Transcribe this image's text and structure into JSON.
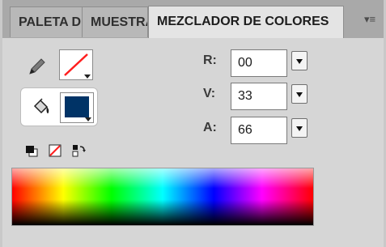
{
  "tabs": [
    {
      "label": "PALETA DE COLORES"
    },
    {
      "label": "MUESTRAS"
    },
    {
      "label": "MEZCLADOR DE COLORES"
    }
  ],
  "colors": {
    "stroke": "none",
    "fill": "#003366"
  },
  "fields": {
    "r": {
      "label": "R:",
      "value": "00"
    },
    "v": {
      "label": "V:",
      "value": "33"
    },
    "a": {
      "label": "A:",
      "value": "66"
    }
  },
  "icons": {
    "stroke": "pencil-icon",
    "fill": "paint-bucket-icon",
    "default_colors": "black-white-icon",
    "no_color": "no-color-icon",
    "swap": "swap-colors-icon",
    "menu": "panel-menu-icon"
  }
}
